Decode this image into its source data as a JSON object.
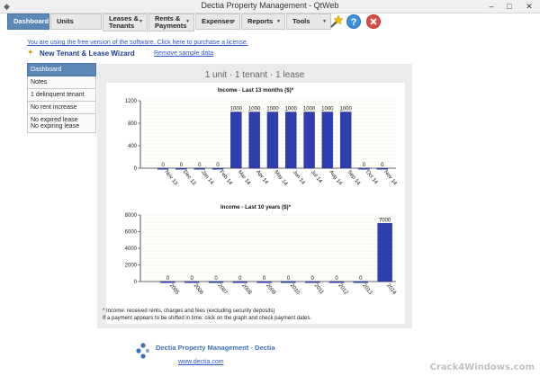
{
  "window": {
    "title": "Dectia Property Management - QtWeb",
    "minimize": "–",
    "maximize": "□",
    "close": "✕"
  },
  "menu": {
    "items": [
      {
        "label": "Dashboard",
        "has_caret": false
      },
      {
        "label": "Units",
        "has_caret": false
      },
      {
        "label": "Leases & Tenants",
        "has_caret": true
      },
      {
        "label": "Rents & Payments",
        "has_caret": true
      },
      {
        "label": "Expenses",
        "has_caret": true
      },
      {
        "label": "Reports",
        "has_caret": true
      },
      {
        "label": "Tools",
        "has_caret": true
      }
    ],
    "icons": [
      "magic-wand-icon",
      "help-icon",
      "close-app-icon"
    ]
  },
  "notice": {
    "free_version": "You are using the free version of the software. Click here to purchase a license."
  },
  "actions": {
    "wizard": "New Tenant & Lease Wizard",
    "remove_sample": "Remove sample data"
  },
  "sidebar": {
    "items": [
      {
        "label": "Dashboard",
        "active": true
      },
      {
        "label": "Notes",
        "active": false
      },
      {
        "label": "1 delinquent tenant",
        "active": false
      },
      {
        "label": "No rent increase",
        "active": false
      },
      {
        "label": "No expired lease",
        "label2": "No expiring lease",
        "active": false
      }
    ]
  },
  "summary": "1 unit · 1 tenant · 1 lease",
  "chart_data": [
    {
      "type": "bar",
      "title": "Income - Last 13 months ($)*",
      "categories": [
        "Nov 13",
        "Dec 13",
        "Jan 14",
        "Feb 14",
        "Mar 14",
        "Apr 14",
        "May 14",
        "Jun 14",
        "Jul 14",
        "Aug 14",
        "Sep 14",
        "Oct 14",
        "Nov 14"
      ],
      "values": [
        0,
        0,
        0,
        0,
        1000,
        1000,
        1000,
        1000,
        1000,
        1000,
        1000,
        0,
        0
      ],
      "yticks": [
        0,
        400,
        800,
        1200
      ],
      "ylim": [
        0,
        1200
      ],
      "grid": true,
      "color": "#2e3fad"
    },
    {
      "type": "bar",
      "title": "Income - Last 10 years ($)*",
      "categories": [
        "2005",
        "2006",
        "2007",
        "2008",
        "2009",
        "2010",
        "2011",
        "2012",
        "2013",
        "2014"
      ],
      "values": [
        0,
        0,
        0,
        0,
        0,
        0,
        0,
        0,
        0,
        7000
      ],
      "yticks": [
        0,
        2000,
        4000,
        6000,
        8000
      ],
      "ylim": [
        0,
        8000
      ],
      "grid": true,
      "color": "#2e3fad"
    }
  ],
  "footnotes": [
    "* Income: received rents, charges and fees (excluding security deposits)",
    "If a payment appears to be shifted in time: click on the graph and check payment dates."
  ],
  "footer": {
    "name": "Dectia Property Management - Dectia",
    "link": "www.dectia.com"
  },
  "watermark": "Crack4Windows.com"
}
